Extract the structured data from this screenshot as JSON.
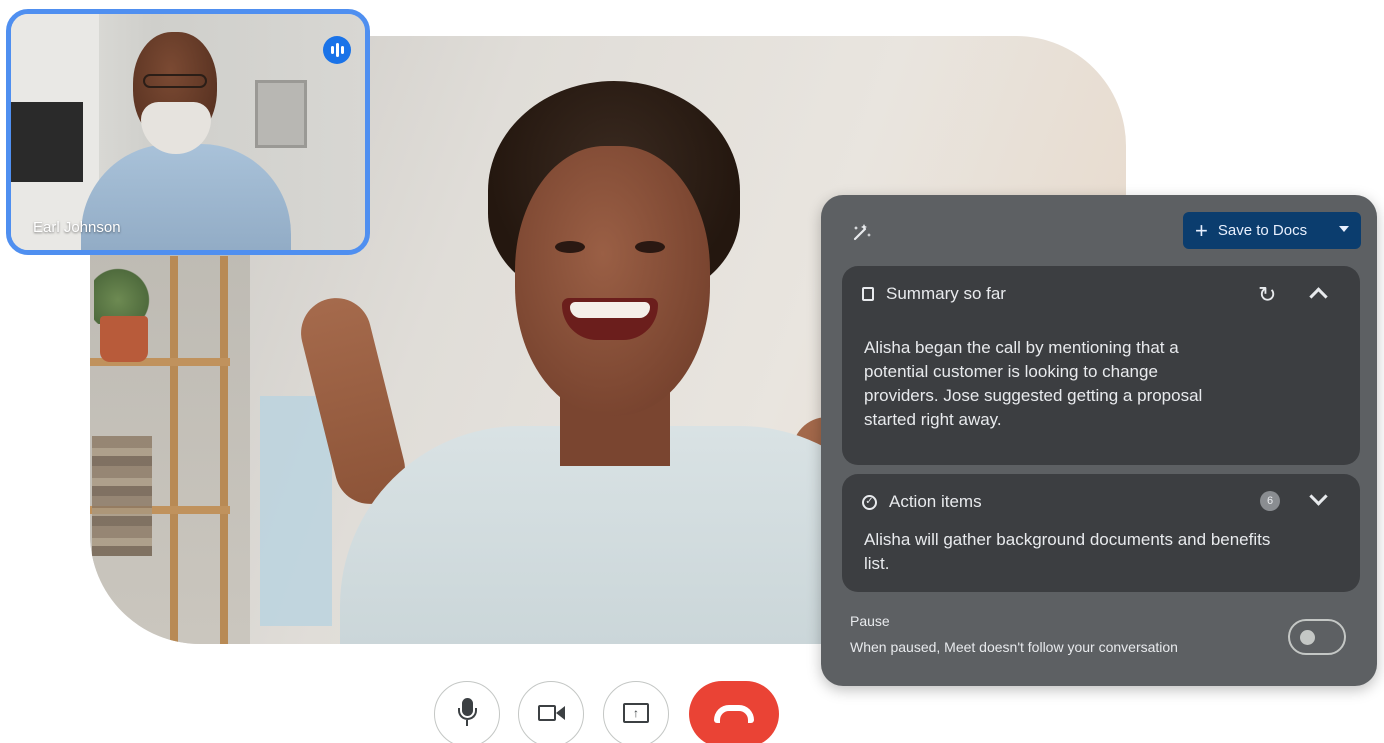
{
  "participants": {
    "thumbnail_name": "Earl Johnson"
  },
  "panel": {
    "save_label": "Save to Docs",
    "summary": {
      "title": "Summary so far",
      "body": "Alisha began the call by mentioning that a potential customer is looking to change providers. Jose suggested getting a proposal started right away."
    },
    "actions": {
      "title": "Action items",
      "count": "6",
      "body": "Alisha will gather background documents and benefits list."
    },
    "pause": {
      "label": "Pause",
      "description": "When paused, Meet doesn't follow your conversation",
      "enabled": false
    }
  },
  "controls": {
    "mic_icon": "mic-icon",
    "camera_icon": "camera-icon",
    "present_icon": "present-icon",
    "hangup_icon": "hangup-icon"
  },
  "colors": {
    "accent": "#1a73e8",
    "hangup": "#ea4335",
    "panel_bg": "#5d6063",
    "card_bg": "#3c3e41",
    "save_button": "#0b3d6e",
    "thumbnail_border": "#4f8ff0"
  }
}
